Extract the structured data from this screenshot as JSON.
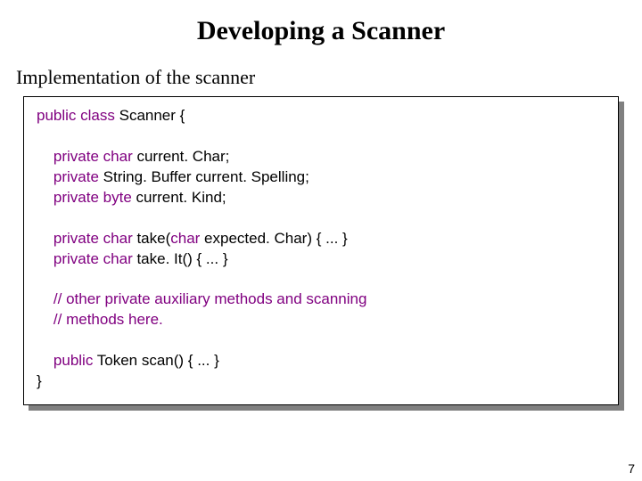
{
  "slide": {
    "title": "Developing a Scanner",
    "subtitle": "Implementation of the scanner",
    "page_number": "7"
  },
  "code": {
    "l1a": "public class ",
    "l1b": "Scanner {",
    "l2a": "private char ",
    "l2b": "current. Char;",
    "l3a": "private ",
    "l3b": "String. Buffer current. Spelling;",
    "l4a": "private byte ",
    "l4b": "current. Kind;",
    "l5a": "private char ",
    "l5b": "take(",
    "l5c": "char ",
    "l5d": "expected. Char) { ... }",
    "l6a": "private char ",
    "l6b": "take. It() { ... }",
    "l7": "// other private auxiliary methods and scanning",
    "l8": "// methods here.",
    "l9a": "public ",
    "l9b": "Token scan() { ... }",
    "l10": "}"
  }
}
